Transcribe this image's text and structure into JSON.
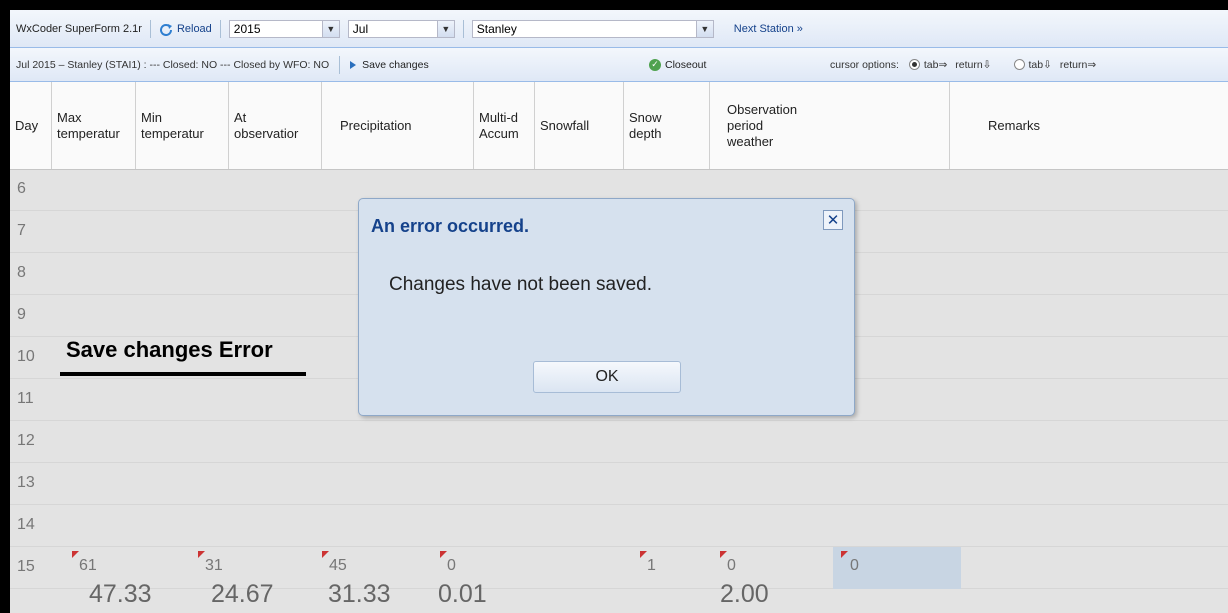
{
  "app_title": "WxCoder SuperForm 2.1r",
  "toolbar": {
    "reload_label": "Reload",
    "year": "2015",
    "month": "Jul",
    "station": "Stanley",
    "next_station_label": "Next Station »"
  },
  "status_bar": {
    "status_text": "Jul 2015 – Stanley (STAI1) : --- Closed: NO --- Closed by WFO: NO",
    "save_label": "Save changes",
    "closeout_label": "Closeout",
    "cursor_options_label": "cursor options:",
    "opt1_a": "tab⇒",
    "opt1_b": "return⇩",
    "opt2_a": "tab⇩",
    "opt2_b": "return⇒"
  },
  "columns": {
    "day": "Day",
    "max_a": "Max",
    "max_b": "temperatur",
    "min_a": "Min",
    "min_b": "temperatur",
    "at_a": "At",
    "at_b": "observatior",
    "precip": "Precipitation",
    "multi_a": "Multi-d",
    "multi_b": "Accum",
    "snowfall": "Snowfall",
    "depth_a": "Snow",
    "depth_b": "depth",
    "obs_a": "Observation",
    "obs_b": "period",
    "obs_c": "weather",
    "remarks": "Remarks"
  },
  "rows": {
    "r6": "6",
    "r7": "7",
    "r8": "8",
    "r9": "9",
    "r10": "10",
    "r11": "11",
    "r12": "12",
    "r13": "13",
    "r14": "14",
    "r15": "15"
  },
  "row15": {
    "max": "61",
    "min": "31",
    "at": "45",
    "precip": "0",
    "snowfall": "1",
    "depth": "0",
    "weather": "0"
  },
  "totals": {
    "max": "47.33",
    "min": "24.67",
    "at": "31.33",
    "precip": "0.01",
    "depth": "2.00"
  },
  "annotation": "Save changes Error",
  "dialog": {
    "title": "An error occurred.",
    "message": "Changes have not been saved.",
    "ok_label": "OK"
  },
  "colors": {
    "accent": "#15428b",
    "flag": "#cc3333"
  }
}
